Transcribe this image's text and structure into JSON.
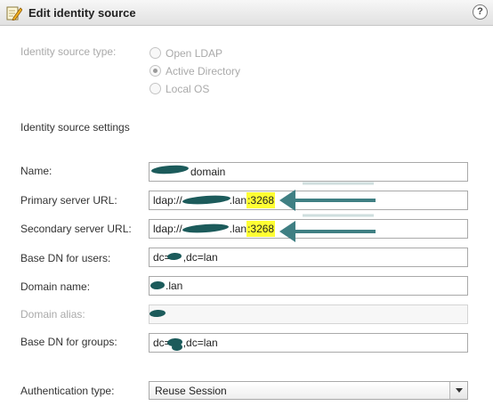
{
  "window": {
    "title": "Edit identity source",
    "help_glyph": "?"
  },
  "identity_source_type": {
    "label": "Identity source type:",
    "options": [
      {
        "label": "Open LDAP",
        "selected": false
      },
      {
        "label": "Active Directory",
        "selected": true
      },
      {
        "label": "Local OS",
        "selected": false
      }
    ]
  },
  "settings": {
    "section_title": "Identity source settings",
    "name": {
      "label": "Name:",
      "value": "domain"
    },
    "primary_url": {
      "label": "Primary server URL:",
      "prefix": "ldap://",
      "mid": ".lan",
      "port": ":3268"
    },
    "secondary_url": {
      "label": "Secondary server URL:",
      "prefix": "ldap://",
      "mid": ".lan",
      "port": ":3268"
    },
    "base_dn_users": {
      "label": "Base DN for users:",
      "prefix": "dc=",
      "suffix": ",dc=lan"
    },
    "domain_name": {
      "label": "Domain name:",
      "value": ".lan"
    },
    "domain_alias": {
      "label": "Domain alias:",
      "value": ""
    },
    "base_dn_groups": {
      "label": "Base DN for groups:",
      "prefix": "dc=",
      "suffix": ",dc=lan"
    },
    "auth_type": {
      "label": "Authentication type:",
      "value": "Reuse Session"
    }
  },
  "colors": {
    "highlight": "#ffff33",
    "redaction": "#1c5b5b",
    "annotation_arrow": "#3f7f83"
  }
}
